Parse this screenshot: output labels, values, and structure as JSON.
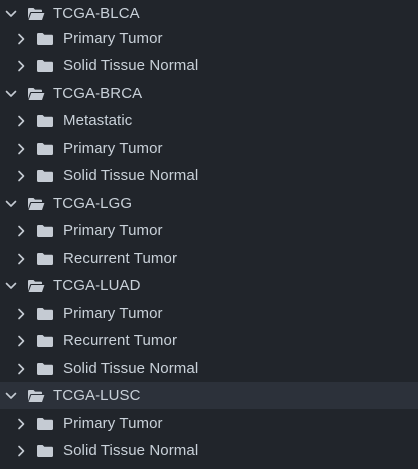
{
  "tree": {
    "groups": [
      {
        "label": "TCGA-BLCA",
        "expanded": true,
        "selected": false,
        "children": [
          "Primary Tumor",
          "Solid Tissue Normal"
        ]
      },
      {
        "label": "TCGA-BRCA",
        "expanded": true,
        "selected": false,
        "children": [
          "Metastatic",
          "Primary Tumor",
          "Solid Tissue Normal"
        ]
      },
      {
        "label": "TCGA-LGG",
        "expanded": true,
        "selected": false,
        "children": [
          "Primary Tumor",
          "Recurrent Tumor"
        ]
      },
      {
        "label": "TCGA-LUAD",
        "expanded": true,
        "selected": false,
        "children": [
          "Primary Tumor",
          "Recurrent Tumor",
          "Solid Tissue Normal"
        ]
      },
      {
        "label": "TCGA-LUSC",
        "expanded": true,
        "selected": true,
        "children": [
          "Primary Tumor",
          "Solid Tissue Normal"
        ]
      }
    ]
  },
  "icons": {
    "expanded_chevron": "chevron-down-icon",
    "collapsed_chevron": "chevron-right-icon",
    "open_folder": "folder-open-icon",
    "closed_folder": "folder-icon"
  },
  "colors": {
    "background": "#21252b",
    "selected_row": "#2c313a",
    "text": "#c9d1d9",
    "icon": "#c5cbd3"
  }
}
